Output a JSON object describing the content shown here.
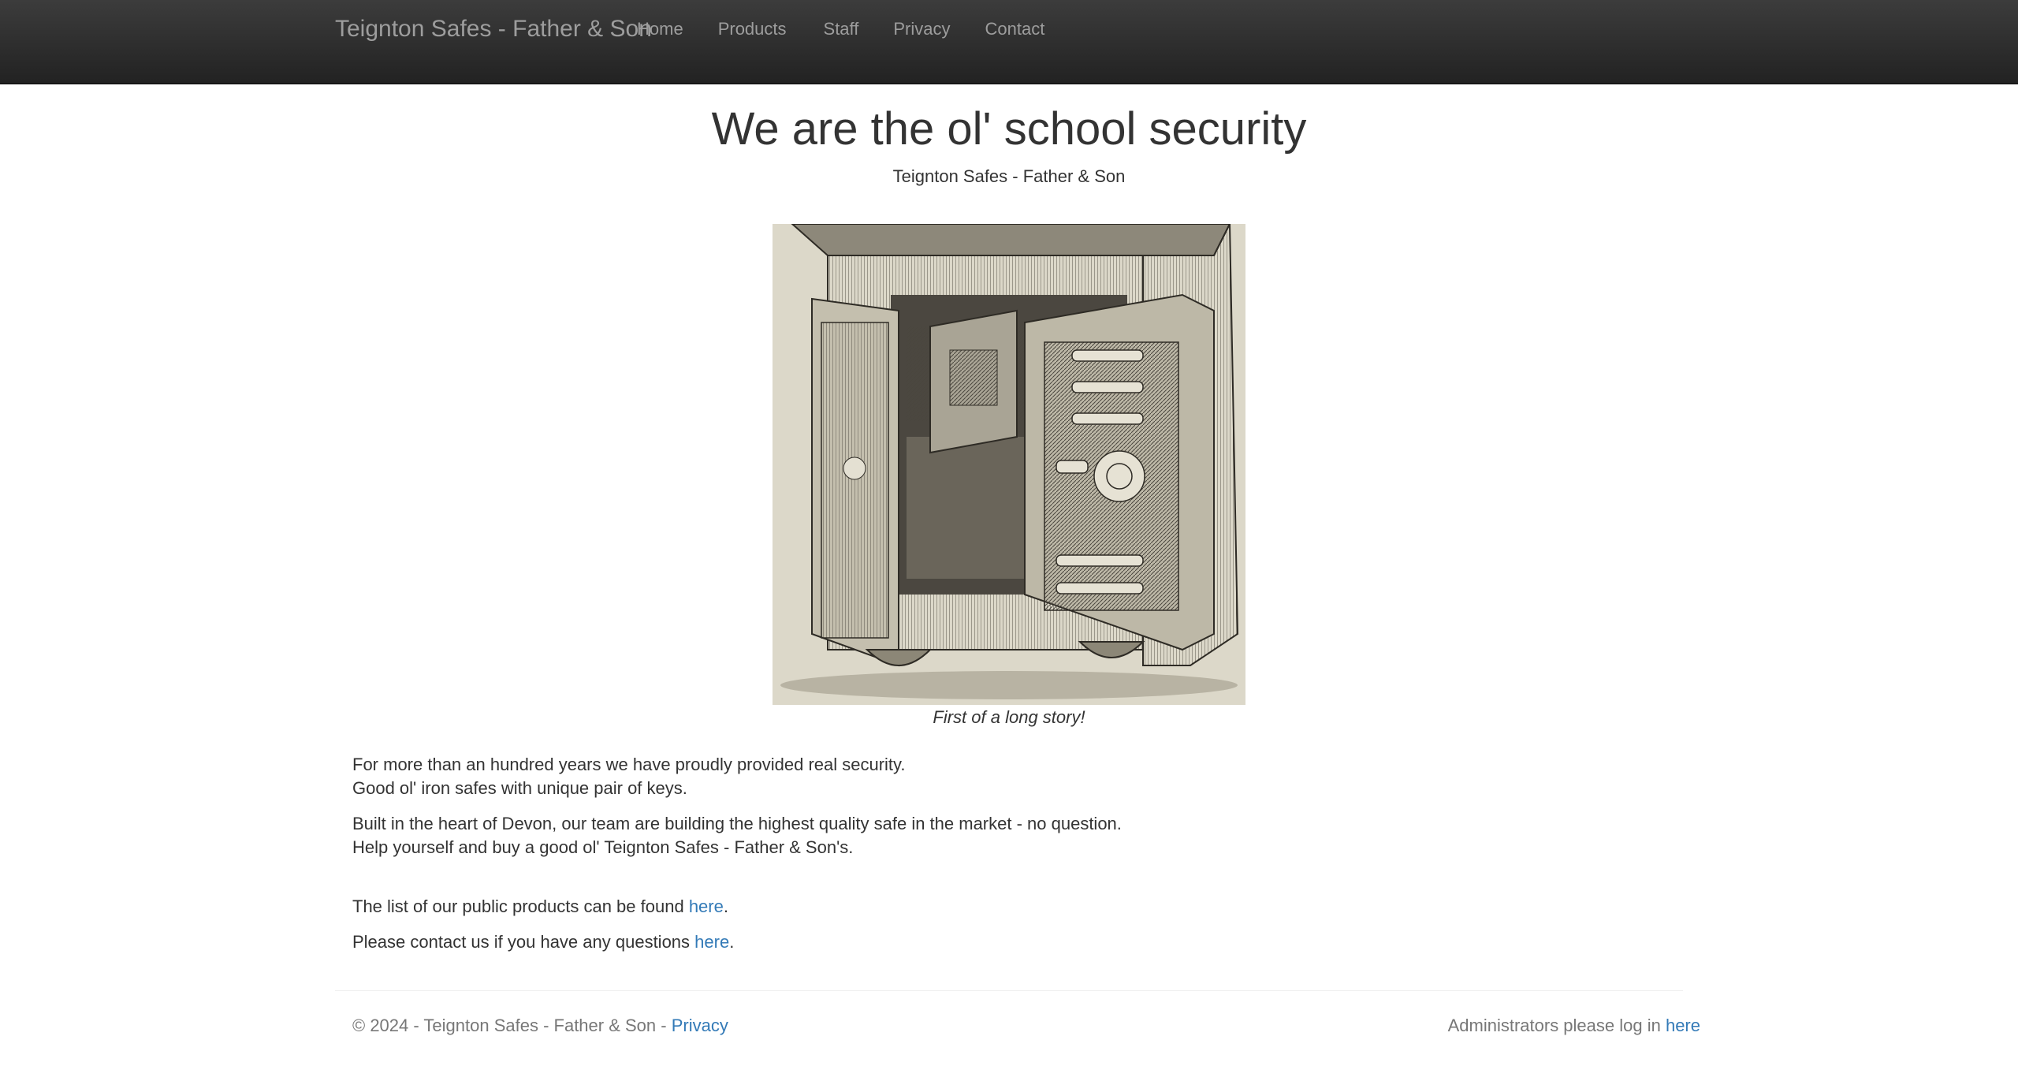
{
  "navbar": {
    "brand": "Teignton Safes - Father & Son",
    "items": [
      {
        "label": "Home"
      },
      {
        "label": "Products"
      },
      {
        "label": "Staff"
      },
      {
        "label": "Privacy"
      },
      {
        "label": "Contact"
      }
    ]
  },
  "hero": {
    "title": "We are the ol' school security",
    "subtitle": "Teignton Safes - Father & Son",
    "image_alt": "antique open safe engraving",
    "caption": "First of a long story!"
  },
  "content": {
    "p1_line1": "For more than an hundred years we have proudly provided real security.",
    "p1_line2": "Good ol' iron safes with unique pair of keys.",
    "p2_line1": "Built in the heart of Devon, our team are building the highest quality safe in the market - no question.",
    "p2_line2": "Help yourself and buy a good ol' Teignton Safes - Father & Son's.",
    "products_text": "The list of our public products can be found ",
    "products_link": "here",
    "products_end": ".",
    "contact_text": "Please contact us if you have any questions ",
    "contact_link": "here",
    "contact_end": "."
  },
  "footer": {
    "copyright": "© 2024 - Teignton Safes - Father & Son - ",
    "privacy_link": "Privacy",
    "admin_text": "Administrators please log in ",
    "admin_link": "here"
  },
  "colors": {
    "navbar_bg": "#222222",
    "nav_text": "#9d9d9d",
    "link": "#337ab7",
    "text": "#333333",
    "muted": "#777777"
  }
}
